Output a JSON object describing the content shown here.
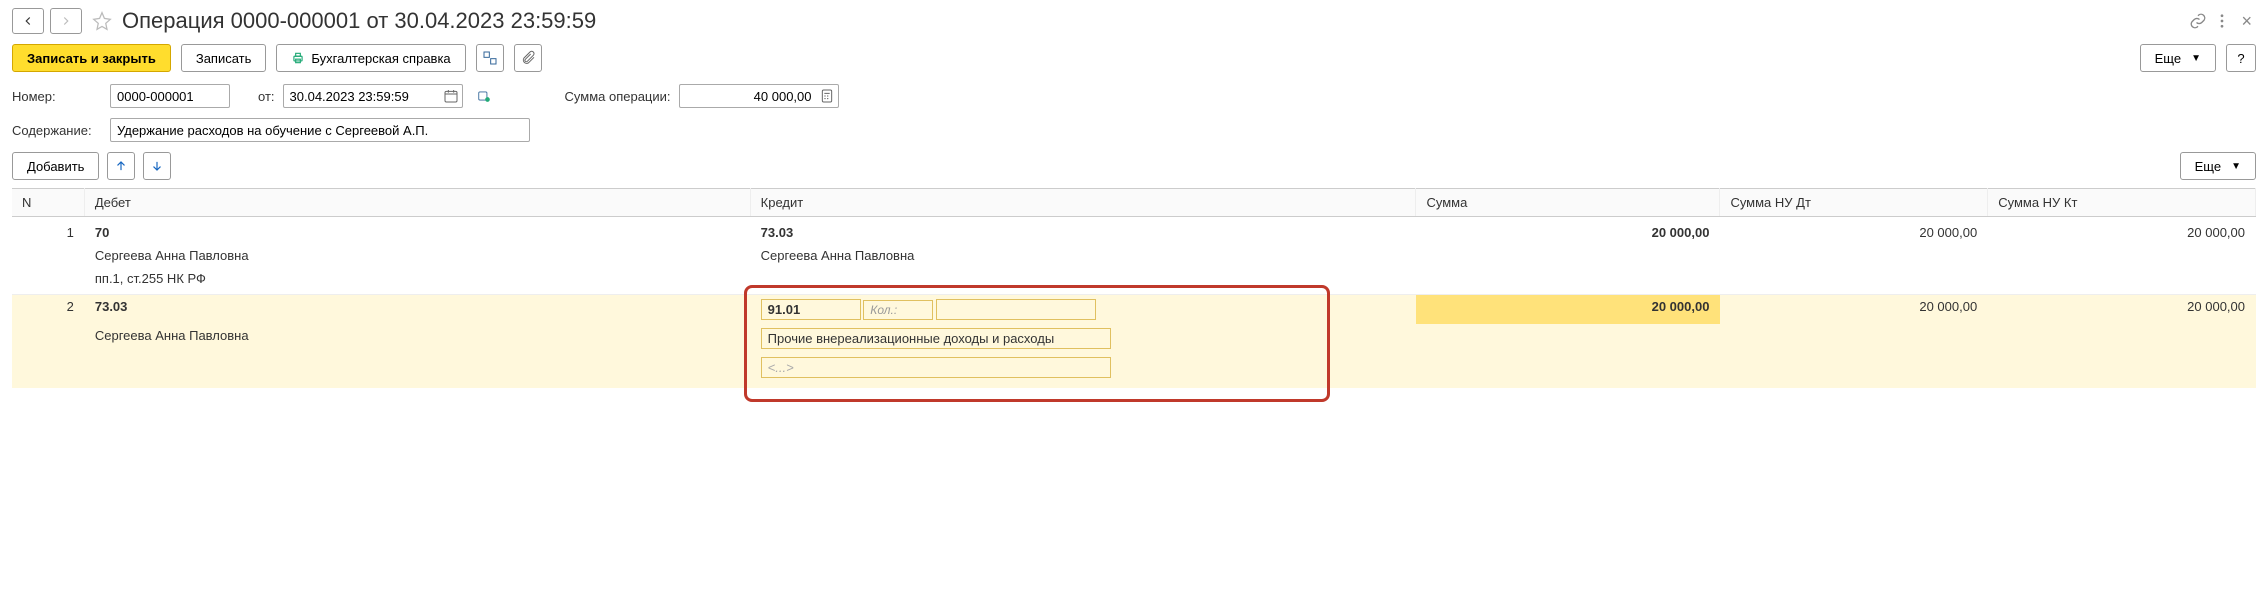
{
  "header": {
    "title": "Операция 0000-000001 от 30.04.2023 23:59:59"
  },
  "toolbar": {
    "save_close": "Записать и закрыть",
    "save": "Записать",
    "report": "Бухгалтерская справка",
    "more": "Еще",
    "help": "?"
  },
  "form": {
    "number_label": "Номер:",
    "number_value": "0000-000001",
    "from_label": "от:",
    "date_value": "30.04.2023 23:59:59",
    "sum_label": "Сумма операции:",
    "sum_value": "40 000,00",
    "content_label": "Содержание:",
    "content_value": "Удержание расходов на обучение с Сергеевой А.П."
  },
  "table_toolbar": {
    "add": "Добавить",
    "more": "Еще"
  },
  "columns": {
    "n": "N",
    "debet": "Дебет",
    "kredit": "Кредит",
    "sum": "Сумма",
    "nu_dt": "Сумма НУ Дт",
    "nu_kt": "Сумма НУ Кт"
  },
  "rows": [
    {
      "n": "1",
      "debet_acct": "70",
      "debet_sub1": "Сергеева Анна Павловна",
      "debet_sub2": "пп.1, ст.255 НК РФ",
      "kredit_acct": "73.03",
      "kredit_sub1": "Сергеева Анна Павловна",
      "sum": "20 000,00",
      "nu_dt": "20 000,00",
      "nu_kt": "20 000,00"
    },
    {
      "n": "2",
      "debet_acct": "73.03",
      "debet_sub1": "Сергеева Анна Павловна",
      "kredit_acct": "91.01",
      "kredit_qty_label": "Кол.:",
      "kredit_sub1": "Прочие внереализационные доходы и расходы",
      "kredit_sub2": "<...>",
      "sum": "20 000,00",
      "nu_dt": "20 000,00",
      "nu_kt": "20 000,00"
    }
  ]
}
